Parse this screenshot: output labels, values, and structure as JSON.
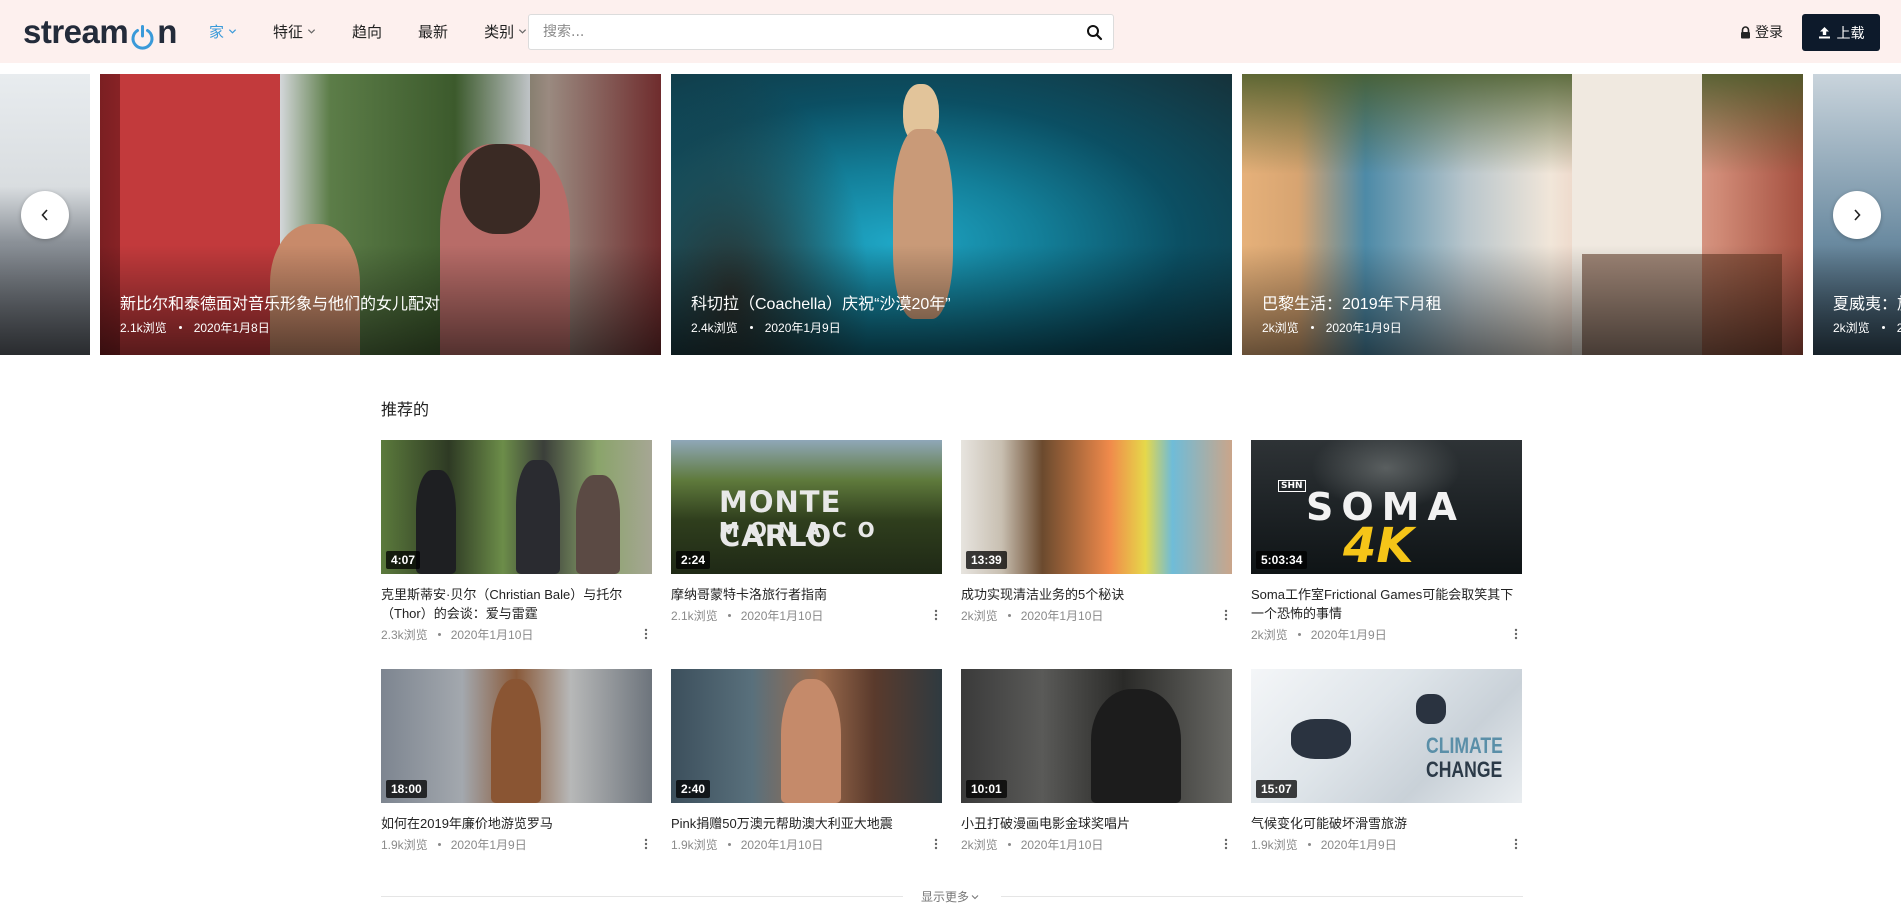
{
  "header": {
    "logo_text_1": "stream",
    "logo_text_2": "n",
    "nav": [
      {
        "label": "家",
        "active": true,
        "dropdown": true
      },
      {
        "label": "特征",
        "active": false,
        "dropdown": true
      },
      {
        "label": "趋向",
        "active": false,
        "dropdown": false
      },
      {
        "label": "最新",
        "active": false,
        "dropdown": false
      },
      {
        "label": "类别",
        "active": false,
        "dropdown": true
      }
    ],
    "search_placeholder": "搜索...",
    "login_label": "登录",
    "upload_label": "上载",
    "accent_color": "#3a9ad9"
  },
  "slider": {
    "slides": [
      {
        "title": "",
        "views": "",
        "date": ""
      },
      {
        "title": "新比尔和泰德面对音乐形象与他们的女儿配对",
        "views": "2.1k浏览",
        "date": "2020年1月8日"
      },
      {
        "title": "科切拉（Coachella）庆祝“沙漠20年”",
        "views": "2.4k浏览",
        "date": "2020年1月9日"
      },
      {
        "title": "巴黎生活：2019年下月租",
        "views": "2k浏览",
        "date": "2020年1月9日"
      },
      {
        "title": "夏威夷：旅",
        "views": "2k浏览",
        "date": "2"
      }
    ]
  },
  "recommended": {
    "title": "推荐的",
    "videos": [
      {
        "duration": "4:07",
        "title": "克里斯蒂安·贝尔（Christian Bale）与托尔（Thor）的会谈：爱与雷霆",
        "views": "2.3k浏览",
        "date": "2020年1月10日"
      },
      {
        "duration": "2:24",
        "title": "摩纳哥蒙特卡洛旅行者指南",
        "views": "2.1k浏览",
        "date": "2020年1月10日",
        "thumb_text_1": "MONTE CARLO",
        "thumb_text_2": "M O N A C O"
      },
      {
        "duration": "13:39",
        "title": "成功实现清洁业务的5个秘诀",
        "views": "2k浏览",
        "date": "2020年1月10日"
      },
      {
        "duration": "5:03:34",
        "title": "Soma工作室Frictional Games可能会取笑其下一个恐怖的事情",
        "views": "2k浏览",
        "date": "2020年1月9日",
        "thumb_text_1": "SOMA",
        "thumb_text_2": "4K",
        "thumb_text_3": "SHN"
      },
      {
        "duration": "18:00",
        "title": "如何在2019年廉价地游览罗马",
        "views": "1.9k浏览",
        "date": "2020年1月9日"
      },
      {
        "duration": "2:40",
        "title": "Pink捐赠50万澳元帮助澳大利亚大地震",
        "views": "1.9k浏览",
        "date": "2020年1月10日"
      },
      {
        "duration": "10:01",
        "title": "小丑打破漫画电影金球奖唱片",
        "views": "2k浏览",
        "date": "2020年1月10日"
      },
      {
        "duration": "15:07",
        "title": "气候变化可能破坏滑雪旅游",
        "views": "1.9k浏览",
        "date": "2020年1月9日",
        "thumb_text_1": "CLIMATE",
        "thumb_text_2": "CHANGE"
      }
    ],
    "show_more_label": "显示更多"
  }
}
